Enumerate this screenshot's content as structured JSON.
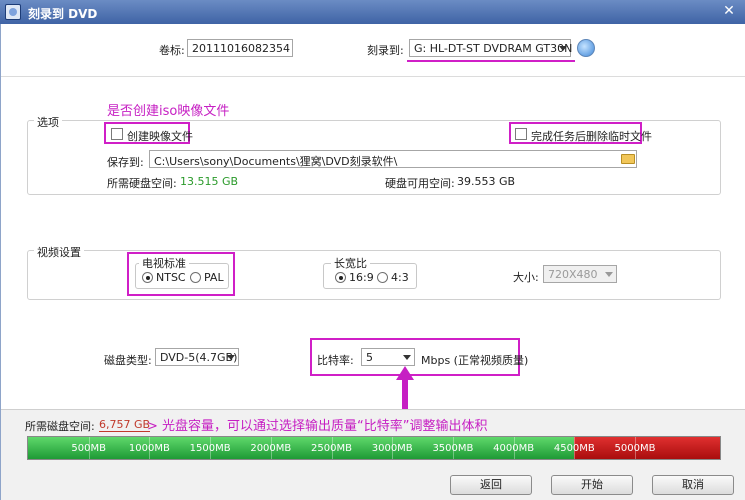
{
  "window": {
    "title": "刻录到 DVD",
    "close_glyph": "✕"
  },
  "top": {
    "volume_label": "卷标:",
    "volume_value": "20111016082354",
    "burn_to_label": "刻录到:",
    "burn_to_value": "G: HL-DT-ST DVDRAM GT30N"
  },
  "options": {
    "group_title": "选项",
    "annotation": "是否创建iso映像文件",
    "create_image_label": "创建映像文件",
    "delete_temp_label": "完成任务后删除临时文件",
    "save_to_label": "保存到:",
    "save_to_value": "C:\\Users\\sony\\Documents\\狸窝\\DVD刻录软件\\",
    "required_space_label": "所需硬盘空间:",
    "required_space_value": "13.515 GB",
    "available_space_label": "硬盘可用空间:",
    "available_space_value": "39.553 GB"
  },
  "video": {
    "group_title": "视频设置",
    "tv_standard_title": "电视标准",
    "ntsc_label": "NTSC",
    "pal_label": "PAL",
    "aspect_title": "长宽比",
    "aspect_169_label": "16:9",
    "aspect_43_label": "4:3",
    "size_label": "大小:",
    "size_value": "720X480",
    "tv_standard_selected": "NTSC",
    "aspect_selected": "16:9"
  },
  "disc": {
    "type_label": "磁盘类型:",
    "type_value": "DVD-5(4.7GB)",
    "bitrate_label": "比特率:",
    "bitrate_value": "5",
    "bitrate_unit": "Mbps (正常视频质量)"
  },
  "capacity": {
    "label": "所需磁盘空间:",
    "value": "6,757 GB",
    "annotation": "> 光盘容量，可以通过选择输出质量“比特率”调整输出体积",
    "max_mb": 5700,
    "capacity_mb": 4500,
    "used_mb": 5700,
    "ticks": [
      "500MB",
      "1000MB",
      "1500MB",
      "2000MB",
      "2500MB",
      "3000MB",
      "3500MB",
      "4000MB",
      "4500MB",
      "5000MB"
    ]
  },
  "buttons": {
    "back": "返回",
    "start": "开始",
    "cancel": "取消"
  },
  "colors": {
    "annotation": "#c61fc3",
    "space_green": "#2a9a2a",
    "capacity_red": "#c0392b"
  }
}
